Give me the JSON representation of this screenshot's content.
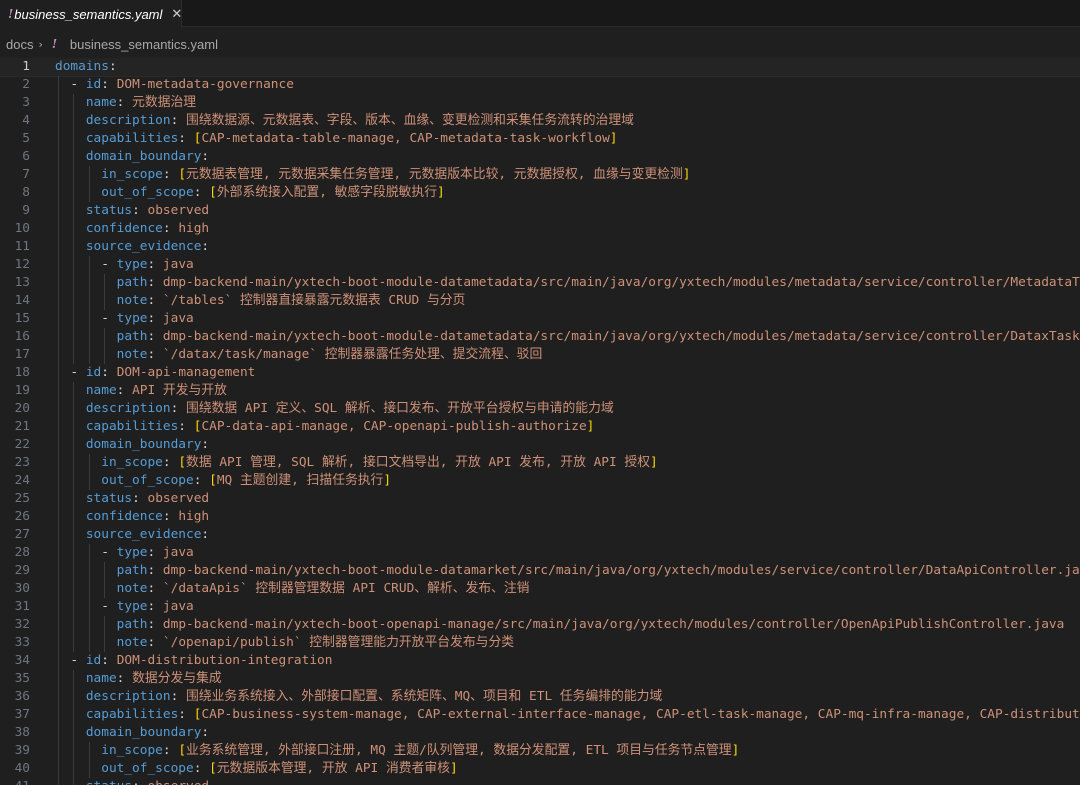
{
  "tab": {
    "label": "business_semantics.yaml",
    "icon": "!",
    "close": "✕"
  },
  "breadcrumb": {
    "folder": "docs",
    "separator": "›",
    "icon": "!",
    "file": "business_semantics.yaml"
  },
  "editor": {
    "current_line": 1,
    "lines": [
      {
        "n": 1,
        "indent": 0,
        "key": "domains",
        "value": ""
      },
      {
        "n": 2,
        "indent": 2,
        "dash": true,
        "key": "id",
        "value": "DOM-metadata-governance"
      },
      {
        "n": 3,
        "indent": 4,
        "key": "name",
        "value": "元数据治理"
      },
      {
        "n": 4,
        "indent": 4,
        "key": "description",
        "value": "围绕数据源、元数据表、字段、版本、血缘、变更检测和采集任务流转的治理域"
      },
      {
        "n": 5,
        "indent": 4,
        "key": "capabilities",
        "flow": true,
        "value": "CAP-metadata-table-manage, CAP-metadata-task-workflow"
      },
      {
        "n": 6,
        "indent": 4,
        "key": "domain_boundary",
        "value": ""
      },
      {
        "n": 7,
        "indent": 6,
        "key": "in_scope",
        "flow": true,
        "value": "元数据表管理, 元数据采集任务管理, 元数据版本比较, 元数据授权, 血缘与变更检测"
      },
      {
        "n": 8,
        "indent": 6,
        "key": "out_of_scope",
        "flow": true,
        "value": "外部系统接入配置, 敏感字段脱敏执行"
      },
      {
        "n": 9,
        "indent": 4,
        "key": "status",
        "value": "observed"
      },
      {
        "n": 10,
        "indent": 4,
        "key": "confidence",
        "value": "high"
      },
      {
        "n": 11,
        "indent": 4,
        "key": "source_evidence",
        "value": ""
      },
      {
        "n": 12,
        "indent": 6,
        "dash": true,
        "key": "type",
        "value": "java"
      },
      {
        "n": 13,
        "indent": 8,
        "key": "path",
        "value": "dmp-backend-main/yxtech-boot-module-datametadata/src/main/java/org/yxtech/modules/metadata/service/controller/MetadataTableController.java"
      },
      {
        "n": 14,
        "indent": 8,
        "key": "note",
        "value": "`/tables` 控制器直接暴露元数据表 CRUD 与分页"
      },
      {
        "n": 15,
        "indent": 6,
        "dash": true,
        "key": "type",
        "value": "java"
      },
      {
        "n": 16,
        "indent": 8,
        "key": "path",
        "value": "dmp-backend-main/yxtech-boot-module-datametadata/src/main/java/org/yxtech/modules/metadata/service/controller/DataxTaskManageController.java"
      },
      {
        "n": 17,
        "indent": 8,
        "key": "note",
        "value": "`/datax/task/manage` 控制器暴露任务处理、提交流程、驳回"
      },
      {
        "n": 18,
        "indent": 2,
        "dash": true,
        "key": "id",
        "value": "DOM-api-management"
      },
      {
        "n": 19,
        "indent": 4,
        "key": "name",
        "value": "API 开发与开放"
      },
      {
        "n": 20,
        "indent": 4,
        "key": "description",
        "value": "围绕数据 API 定义、SQL 解析、接口发布、开放平台授权与申请的能力域"
      },
      {
        "n": 21,
        "indent": 4,
        "key": "capabilities",
        "flow": true,
        "value": "CAP-data-api-manage, CAP-openapi-publish-authorize"
      },
      {
        "n": 22,
        "indent": 4,
        "key": "domain_boundary",
        "value": ""
      },
      {
        "n": 23,
        "indent": 6,
        "key": "in_scope",
        "flow": true,
        "value": "数据 API 管理, SQL 解析, 接口文档导出, 开放 API 发布, 开放 API 授权"
      },
      {
        "n": 24,
        "indent": 6,
        "key": "out_of_scope",
        "flow": true,
        "value": "MQ 主题创建, 扫描任务执行"
      },
      {
        "n": 25,
        "indent": 4,
        "key": "status",
        "value": "observed"
      },
      {
        "n": 26,
        "indent": 4,
        "key": "confidence",
        "value": "high"
      },
      {
        "n": 27,
        "indent": 4,
        "key": "source_evidence",
        "value": ""
      },
      {
        "n": 28,
        "indent": 6,
        "dash": true,
        "key": "type",
        "value": "java"
      },
      {
        "n": 29,
        "indent": 8,
        "key": "path",
        "value": "dmp-backend-main/yxtech-boot-module-datamarket/src/main/java/org/yxtech/modules/service/controller/DataApiController.java"
      },
      {
        "n": 30,
        "indent": 8,
        "key": "note",
        "value": "`/dataApis` 控制器管理数据 API CRUD、解析、发布、注销"
      },
      {
        "n": 31,
        "indent": 6,
        "dash": true,
        "key": "type",
        "value": "java"
      },
      {
        "n": 32,
        "indent": 8,
        "key": "path",
        "value": "dmp-backend-main/yxtech-boot-openapi-manage/src/main/java/org/yxtech/modules/controller/OpenApiPublishController.java"
      },
      {
        "n": 33,
        "indent": 8,
        "key": "note",
        "value": "`/openapi/publish` 控制器管理能力开放平台发布与分类"
      },
      {
        "n": 34,
        "indent": 2,
        "dash": true,
        "key": "id",
        "value": "DOM-distribution-integration"
      },
      {
        "n": 35,
        "indent": 4,
        "key": "name",
        "value": "数据分发与集成"
      },
      {
        "n": 36,
        "indent": 4,
        "key": "description",
        "value": "围绕业务系统接入、外部接口配置、系统矩阵、MQ、项目和 ETL 任务编排的能力域"
      },
      {
        "n": 37,
        "indent": 4,
        "key": "capabilities",
        "flow": true,
        "value": "CAP-business-system-manage, CAP-external-interface-manage, CAP-etl-task-manage, CAP-mq-infra-manage, CAP-distribution-delivery"
      },
      {
        "n": 38,
        "indent": 4,
        "key": "domain_boundary",
        "value": ""
      },
      {
        "n": 39,
        "indent": 6,
        "key": "in_scope",
        "flow": true,
        "value": "业务系统管理, 外部接口注册, MQ 主题/队列管理, 数据分发配置, ETL 项目与任务节点管理"
      },
      {
        "n": 40,
        "indent": 6,
        "key": "out_of_scope",
        "flow": true,
        "value": "元数据版本管理, 开放 API 消费者审核"
      },
      {
        "n": 41,
        "indent": 4,
        "key": "status",
        "value": "observed"
      }
    ]
  }
}
